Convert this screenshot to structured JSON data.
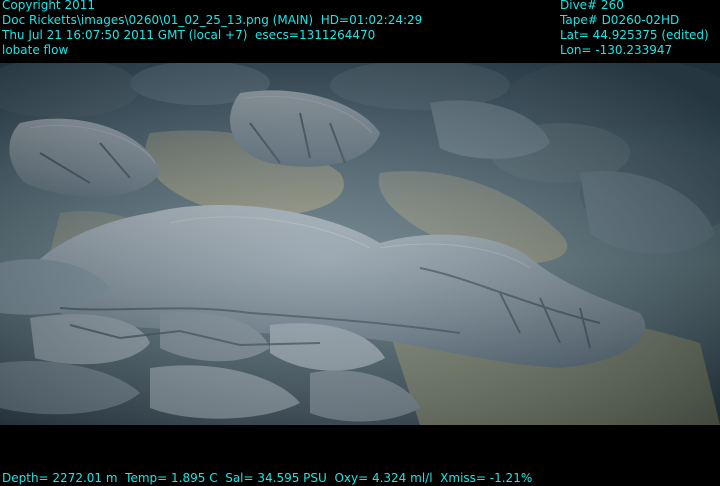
{
  "overlay": {
    "top_left": [
      "Copyright 2011",
      "Doc Ricketts\\images\\0260\\01_02_25_13.png (MAIN)  HD=01:02:24:29",
      "Thu Jul 21 16:07:50 2011 GMT (local +7)  esecs=1311264470",
      "lobate flow"
    ],
    "top_right": [
      "Dive# 260",
      "Tape# D0260-02HD",
      "Lat= 44.925375 (edited)",
      "Lon= -130.233947"
    ],
    "bottom": "Depth= 2272.01 m  Temp= 1.895 C  Sal= 34.595 PSU  Oxy= 4.324 ml/l  Xmiss= -1.21%"
  },
  "scene": {
    "description_icon": "seafloor-lava-photo"
  },
  "colors": {
    "overlay_text": "#19e6e6",
    "background": "#000000",
    "sediment": "#7b7f6a",
    "lava_light": "#8c9aa6",
    "lava_dark": "#3c5262",
    "water_dark": "#1f3444"
  }
}
